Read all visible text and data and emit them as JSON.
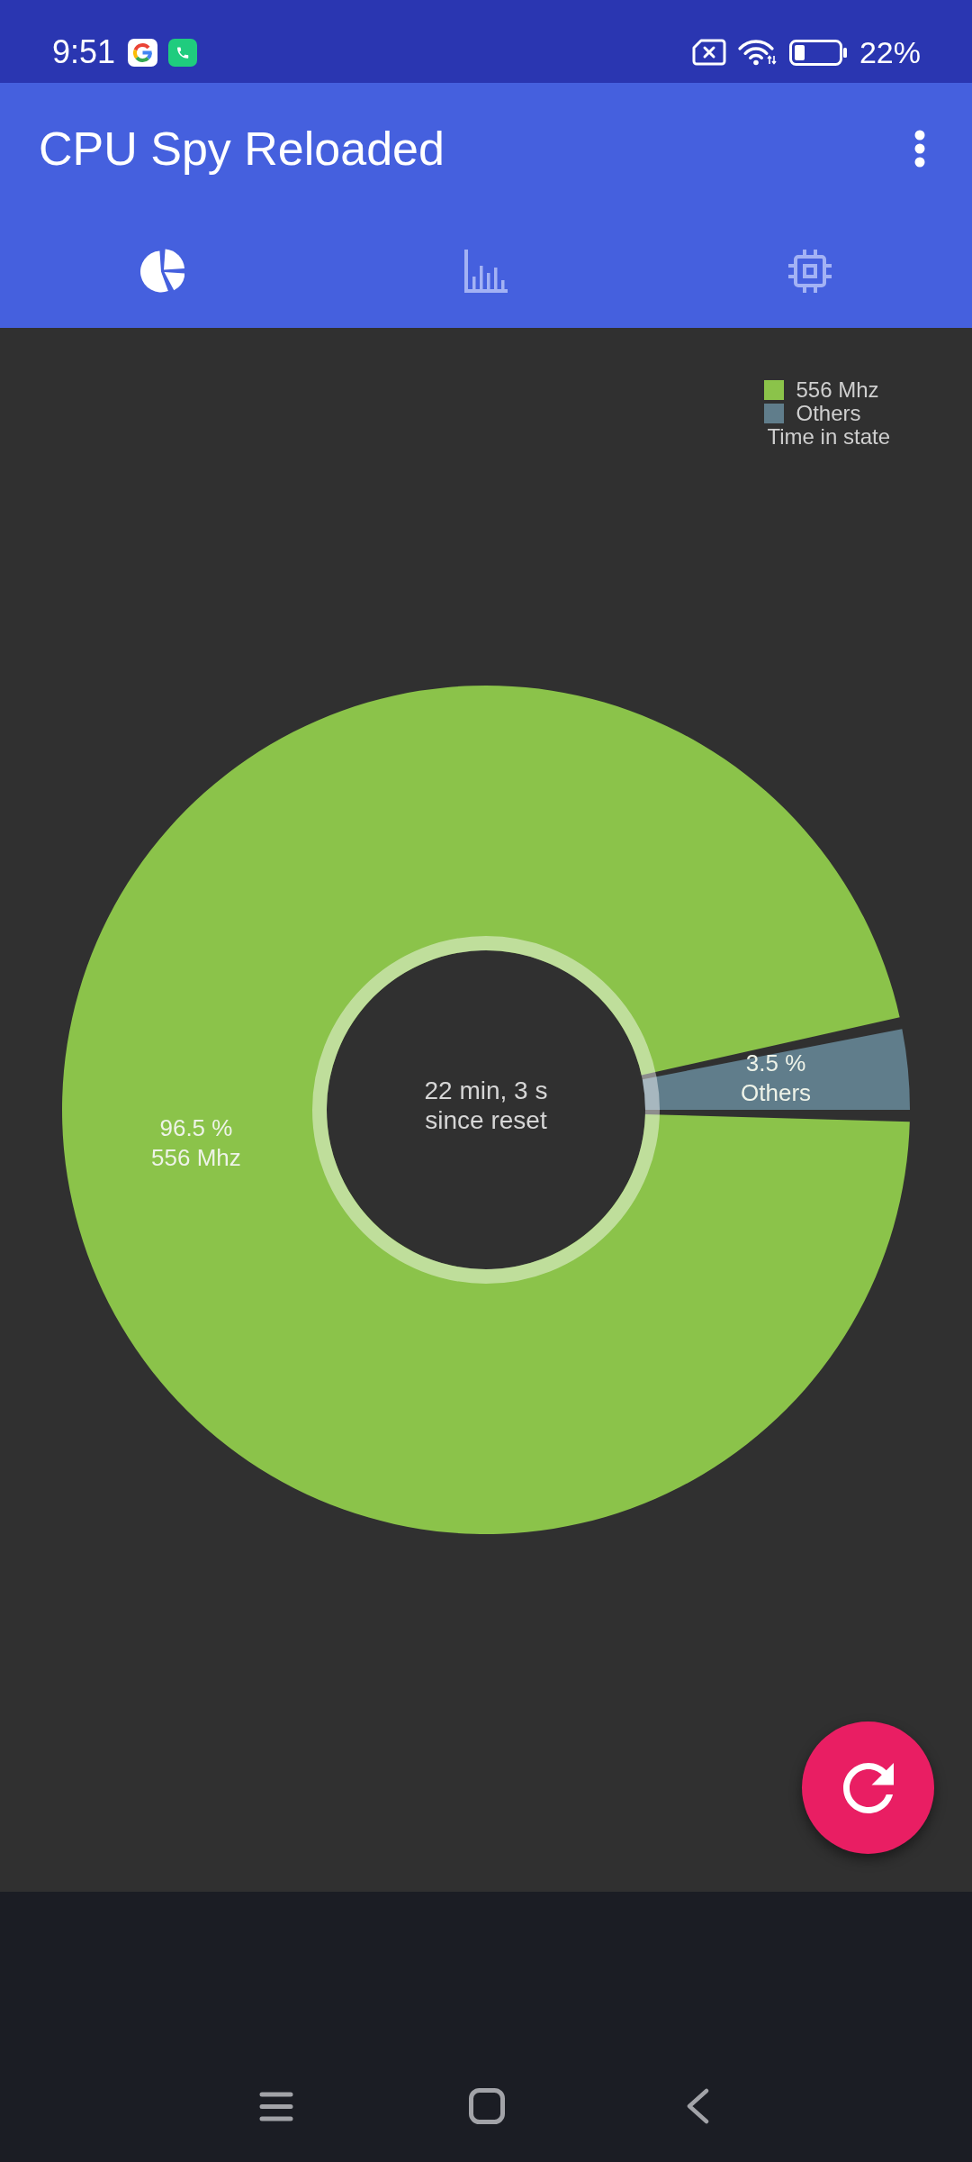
{
  "status_bar": {
    "time": "9:51",
    "battery": "22%"
  },
  "app_bar": {
    "title": "CPU Spy Reloaded"
  },
  "tabs": [
    {
      "selected": true
    },
    {
      "selected": false
    },
    {
      "selected": false
    }
  ],
  "chart": {
    "legend": [
      {
        "label": "556 Mhz",
        "color": "#8bc34a"
      },
      {
        "label": "Others",
        "color": "#607d8b"
      }
    ],
    "chart_data": {
      "type": "donut",
      "categories": [
        "556 Mhz",
        "Others"
      ],
      "series": [
        {
          "name": "Time in state",
          "values": [
            96.5,
            3.5
          ]
        }
      ],
      "value_labels": [
        "96.5 %",
        "3.5 %"
      ]
    },
    "center_text": "22 min, 3 s\nsince reset"
  }
}
